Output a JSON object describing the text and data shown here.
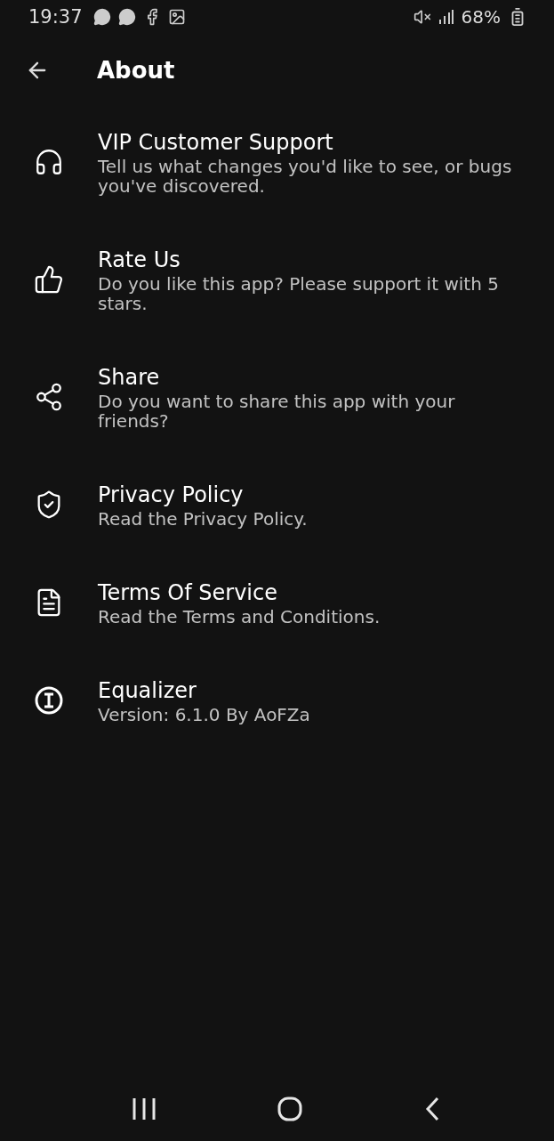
{
  "status_bar": {
    "time": "19:37",
    "notifications": [
      {
        "kind": "chat"
      },
      {
        "kind": "chat"
      },
      {
        "kind": "facebook"
      },
      {
        "kind": "image"
      }
    ],
    "battery": "68%"
  },
  "header": {
    "title": "About"
  },
  "items": [
    {
      "kind": "support",
      "title": "VIP Customer Support",
      "description": "Tell us what changes you'd like to see, or bugs you've discovered."
    },
    {
      "kind": "rate",
      "title": "Rate Us",
      "description": "Do you like this app? Please support it with 5 stars."
    },
    {
      "kind": "share",
      "title": "Share",
      "description": "Do you want to share this app with your friends?"
    },
    {
      "kind": "privacy",
      "title": "Privacy Policy",
      "description": "Read the Privacy Policy."
    },
    {
      "kind": "terms",
      "title": "Terms Of Service",
      "description": "Read the Terms and Conditions."
    },
    {
      "kind": "info",
      "title": "Equalizer",
      "description": "Version: 6.1.0 By AoFZa"
    }
  ]
}
